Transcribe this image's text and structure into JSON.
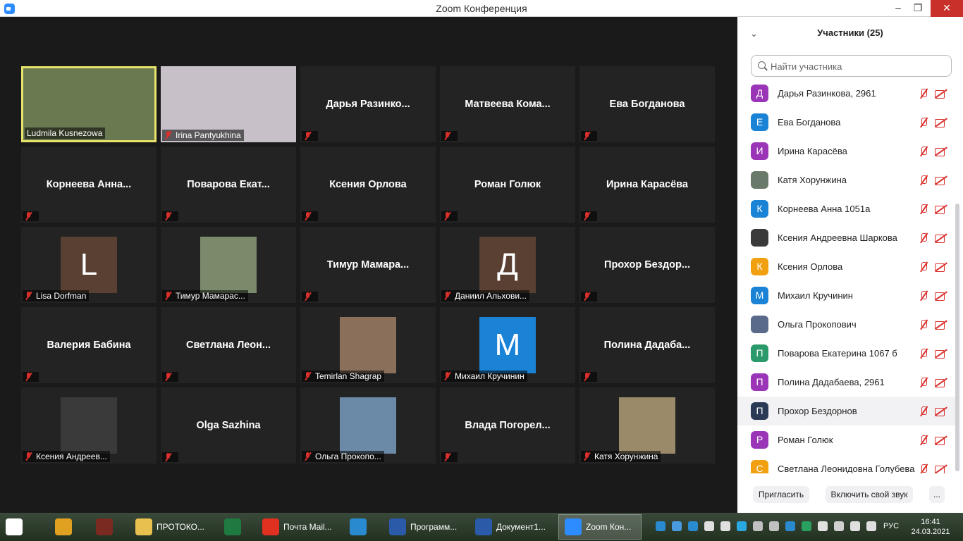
{
  "window": {
    "title": "Zoom Конференция",
    "min": "–",
    "max": "❐",
    "close": "✕"
  },
  "tiles": [
    {
      "type": "video",
      "label": "Ludmila Kusnezowa",
      "active": true,
      "muted": false,
      "bg": "#6a7a50"
    },
    {
      "type": "video",
      "label": "Irina Pantyukhina",
      "muted": true,
      "bg": "#c8c0c8"
    },
    {
      "type": "name",
      "name": "Дарья  Разинко...",
      "muted": true
    },
    {
      "type": "name",
      "name": "Матвеева  Кома...",
      "muted": true
    },
    {
      "type": "name",
      "name": "Ева Богданова",
      "muted": true
    },
    {
      "type": "name",
      "name": "Корнеева  Анна...",
      "muted": true
    },
    {
      "type": "name",
      "name": "Поварова  Екат...",
      "muted": true
    },
    {
      "type": "name",
      "name": "Ксения Орлова",
      "muted": true
    },
    {
      "type": "name",
      "name": "Роман Голюк",
      "muted": true
    },
    {
      "type": "name",
      "name": "Ирина Карасёва",
      "muted": true
    },
    {
      "type": "avatar",
      "letter": "L",
      "color": "#5a3f33",
      "label": "Lisa Dorfman",
      "muted": true
    },
    {
      "type": "photo",
      "color": "#7a8a6a",
      "label": "Тимур Мамарас...",
      "muted": true
    },
    {
      "type": "name",
      "name": "Тимур  Мамара...",
      "muted": true
    },
    {
      "type": "avatar",
      "letter": "Д",
      "color": "#5a3f33",
      "label": "Даниил Альхови...",
      "muted": true
    },
    {
      "type": "name",
      "name": "Прохор  Бездор...",
      "muted": true
    },
    {
      "type": "name",
      "name": "Валерия Бабина",
      "muted": true
    },
    {
      "type": "name",
      "name": "Светлана  Леон...",
      "muted": true
    },
    {
      "type": "photo",
      "color": "#8a6f5a",
      "label": "Temirlan Shagrap",
      "muted": true
    },
    {
      "type": "avatar",
      "letter": "M",
      "color": "#1b83d6",
      "label": "Михаил Кручинин",
      "muted": true
    },
    {
      "type": "name",
      "name": "Полина  Дадаба...",
      "muted": true
    },
    {
      "type": "photo",
      "color": "#3a3a3a",
      "label": "Ксения Андреев...",
      "muted": true
    },
    {
      "type": "name",
      "name": "Olga Sazhina",
      "muted": true
    },
    {
      "type": "photo",
      "color": "#6a8aa8",
      "label": "Ольга Прокопо...",
      "muted": true
    },
    {
      "type": "name",
      "name": "Влада  Погорел...",
      "muted": true
    },
    {
      "type": "photo",
      "color": "#9a8a6a",
      "label": "Катя Хорунжина",
      "muted": true
    }
  ],
  "panel": {
    "title": "Участники (25)",
    "search_placeholder": "Найти участника",
    "participants": [
      {
        "letter": "Д",
        "color": "#9b35b8",
        "name": "Дарья Разинкова, 2961"
      },
      {
        "letter": "Е",
        "color": "#1b83d6",
        "name": "Ева Богданова"
      },
      {
        "letter": "И",
        "color": "#9b35b8",
        "name": "Ирина Карасёва"
      },
      {
        "letter": "",
        "color": "#6a7a6a",
        "name": "Катя Хорунжина"
      },
      {
        "letter": "К",
        "color": "#1b83d6",
        "name": "Корнеева Анна 1051а"
      },
      {
        "letter": "",
        "color": "#3a3a3a",
        "name": "Ксения Андреевна Шаркова"
      },
      {
        "letter": "К",
        "color": "#f0a010",
        "name": "Ксения Орлова"
      },
      {
        "letter": "М",
        "color": "#1b83d6",
        "name": "Михаил Кручинин"
      },
      {
        "letter": "",
        "color": "#5a6a8a",
        "name": "Ольга Прокопович"
      },
      {
        "letter": "П",
        "color": "#2a9a6a",
        "name": "Поварова Екатерина 1067 б"
      },
      {
        "letter": "П",
        "color": "#9b35b8",
        "name": "Полина Дадабаева, 2961"
      },
      {
        "letter": "П",
        "color": "#2a3a55",
        "name": "Прохор Бездорнов",
        "highlight": true
      },
      {
        "letter": "Р",
        "color": "#9b35b8",
        "name": "Роман Голюк"
      },
      {
        "letter": "С",
        "color": "#f0a010",
        "name": "Светлана Леонидовна Голубева"
      }
    ],
    "invite": "Пригласить",
    "unmute": "Включить свой звук",
    "more": "..."
  },
  "taskbar": {
    "items": [
      {
        "name": "start",
        "text": "",
        "color": "#ffffff"
      },
      {
        "name": "chrome",
        "text": "",
        "color": "#e0a020"
      },
      {
        "name": "app",
        "text": "",
        "color": "#7a2a20"
      },
      {
        "name": "folder",
        "text": "ПРОТОКО...",
        "color": "#e8c050"
      },
      {
        "name": "excel",
        "text": "",
        "color": "#1e7a40"
      },
      {
        "name": "yandex",
        "text": "Почта Mail...",
        "color": "#e03020"
      },
      {
        "name": "edge",
        "text": "",
        "color": "#2a8ad0"
      },
      {
        "name": "word1",
        "text": "Программ...",
        "color": "#2a5aa8"
      },
      {
        "name": "word2",
        "text": "Документ1...",
        "color": "#2a5aa8"
      },
      {
        "name": "zoom",
        "text": "Zoom Кон...",
        "color": "#2d8cff",
        "active": true
      }
    ],
    "lang": "РУС",
    "time": "16:41",
    "date": "24.03.2021"
  }
}
